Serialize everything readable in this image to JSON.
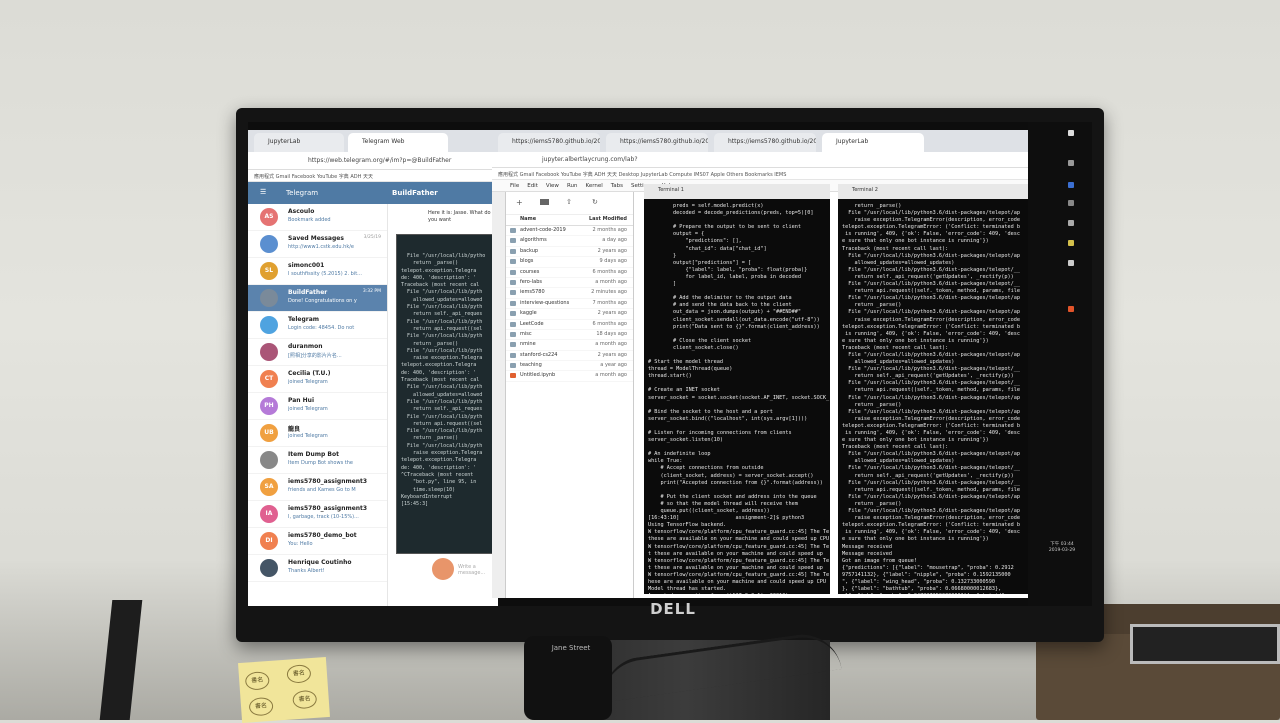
{
  "monitor": {
    "brand": "DELL"
  },
  "power_brick": {
    "label": "Jane Street"
  },
  "sticky_note": {
    "marks": [
      "書名",
      "書名",
      "書名",
      "書名"
    ]
  },
  "telegram": {
    "tab_title_1": "JupyterLab",
    "tab_title_2": "Telegram Web",
    "url": "https://web.telegram.org/#/im?p=@BuildFather",
    "bookmarks": "應用程式  Gmail  Facebook  YouTube  字典  ADH  天天",
    "header_app": "Telegram",
    "header_chat": "BuildFather",
    "bot_message": "Here it is: Jasse. What do you want",
    "input_placeholder": "Write a message...",
    "chats": [
      {
        "initials": "AS",
        "name": "Ascoulo",
        "preview": "Bookmark added",
        "time": "",
        "color": "#e57373"
      },
      {
        "initials": "",
        "name": "Saved Messages",
        "preview": "http://www1.cstk.edu.hk/e",
        "time": "3/25/19",
        "color": "#5b8fd0"
      },
      {
        "initials": "SL",
        "name": "simonc001",
        "preview": "I southfissity (5.2015) 2. bit...",
        "time": "",
        "color": "#e0a030"
      },
      {
        "initials": "",
        "name": "BuildFather",
        "preview": "Done! Congratulations on y",
        "time": "3:32 PM",
        "color": "#7a8a9a"
      },
      {
        "initials": "",
        "name": "Telegram",
        "preview": "Login code: 48454. Do not",
        "time": "",
        "color": "#4fa3e0"
      },
      {
        "initials": "",
        "name": "duranmon",
        "preview": "[照相]分享的影片片名...",
        "time": "",
        "color": "#aa5577"
      },
      {
        "initials": "CT",
        "name": "Cecilia (T.U.)",
        "preview": "joined Telegram",
        "time": "",
        "color": "#f08050"
      },
      {
        "initials": "PH",
        "name": "Pan Hui",
        "preview": "joined Telegram",
        "time": "",
        "color": "#b57ad8"
      },
      {
        "initials": "UB",
        "name": "龍良",
        "preview": "joined Telegram",
        "time": "",
        "color": "#f0a040"
      },
      {
        "initials": "",
        "name": "Item Dump Bot",
        "preview": "Item Dump Bot shows the",
        "time": "",
        "color": "#888888"
      },
      {
        "initials": "SA",
        "name": "iems5780_assignment3",
        "preview": "friends and Kames Go to M",
        "time": "",
        "color": "#f0a040"
      },
      {
        "initials": "IA",
        "name": "iems5780_assignment3",
        "preview": "I, garbage, track (10-15%)...",
        "time": "",
        "color": "#e06090"
      },
      {
        "initials": "DI",
        "name": "iems5780_demo_bot",
        "preview": "You: Hello",
        "time": "",
        "color": "#f08050"
      },
      {
        "initials": "",
        "name": "Henrique Coutinho",
        "preview": "Thanks Albert!",
        "time": "",
        "color": "#445566"
      }
    ]
  },
  "terminal_small": {
    "lines": [
      "  File \"/usr/local/lib/pytho",
      "    return _parse()",
      "telepot.exception.Telegra",
      "de: 400, 'description': '",
      "Traceback (most recent cal",
      "  File \"/usr/local/lib/pyth",
      "    allowed_updates=allowed",
      "  File \"/usr/local/lib/pyth",
      "    return self._api_reques",
      "  File \"/usr/local/lib/pyth",
      "    return api.request((sel",
      "  File \"/usr/local/lib/pyth",
      "    return _parse()",
      "  File \"/usr/local/lib/pyth",
      "    raise exception.Telegra",
      "telepot.exception.Telegra",
      "de: 400, 'description': '",
      "Traceback (most recent cal",
      "  File \"/usr/local/lib/pyth",
      "    allowed_updates=allowed",
      "  File \"/usr/local/lib/pyth",
      "    return self._api_reques",
      "  File \"/usr/local/lib/pyth",
      "    return api.request((sel",
      "  File \"/usr/local/lib/pyth",
      "    return _parse()",
      "  File \"/usr/local/lib/pyth",
      "    raise exception.Telegra",
      "telepot.exception.Telegra",
      "de: 400, 'description': '",
      "^CTraceback (most recent",
      "    \"bot.py\", line 95, in",
      "    time.sleep(10)",
      "KeyboardInterrupt",
      "[15:45:3]"
    ]
  },
  "jupyterlab": {
    "tabs": [
      "https://iems5780.github.io/20",
      "https://iems5780.github.io/20",
      "https://iems5780.github.io/20",
      "JupyterLab"
    ],
    "url": "jupyter.albertlaycrung.com/lab?",
    "bookmarks": "應用程式  Gmail  Facebook  YouTube  字典  ADH  天天  Desktop  JupyterLab  Compute  IMS07  Apple  Others  Bookmarks  IEMS",
    "menu": [
      "File",
      "Edit",
      "View",
      "Run",
      "Kernel",
      "Tabs",
      "Settings",
      "Help"
    ],
    "filebrowser": {
      "col_name": "Name",
      "col_modified": "Last Modified",
      "files": [
        {
          "name": "advent-code-2019",
          "modified": "2 months ago",
          "notebook": false
        },
        {
          "name": "algorithms",
          "modified": "a day ago",
          "notebook": false
        },
        {
          "name": "backup",
          "modified": "2 years ago",
          "notebook": false
        },
        {
          "name": "blogs",
          "modified": "9 days ago",
          "notebook": false
        },
        {
          "name": "courses",
          "modified": "6 months ago",
          "notebook": false
        },
        {
          "name": "fero-labs",
          "modified": "a month ago",
          "notebook": false
        },
        {
          "name": "iems5780",
          "modified": "2 minutes ago",
          "notebook": false
        },
        {
          "name": "interview-questions",
          "modified": "7 months ago",
          "notebook": false
        },
        {
          "name": "kaggle",
          "modified": "2 years ago",
          "notebook": false
        },
        {
          "name": "LeetCode",
          "modified": "6 months ago",
          "notebook": false
        },
        {
          "name": "misc",
          "modified": "18 days ago",
          "notebook": false
        },
        {
          "name": "nmine",
          "modified": "a month ago",
          "notebook": false
        },
        {
          "name": "stanford-cs224",
          "modified": "2 years ago",
          "notebook": false
        },
        {
          "name": "teaching",
          "modified": "a year ago",
          "notebook": false
        },
        {
          "name": "Untitled.ipynb",
          "modified": "a month ago",
          "notebook": true
        }
      ]
    },
    "terminal_1": {
      "title": "Terminal 1",
      "lines": [
        "        preds = self.model.predict(x)",
        "        decoded = decode_predictions(preds, top=5)[0]",
        "",
        "        # Prepare the output to be sent to client",
        "        output = {",
        "            \"predictions\": [],",
        "            \"chat_id\": data[\"chat_id\"]",
        "        }",
        "        output[\"predictions\"] = [",
        "            {\"label\": label, \"proba\": float(proba)}",
        "            for label_id, label, proba in decoded",
        "        ]",
        "",
        "        # Add the delimiter to the output data",
        "        # and send the data back to the client",
        "        out_data = json.dumps(output) + \"##END##\"",
        "        client_socket.sendall(out_data.encode(\"utf-8\"))",
        "        print(\"Data sent to {}\".format(client_address))",
        "",
        "        # Close the client socket",
        "        client_socket.close()",
        "",
        "# Start the model thread",
        "thread = ModelThread(queue)",
        "thread.start()",
        "",
        "# Create an INET socket",
        "server_socket = socket.socket(socket.AF_INET, socket.SOCK_",
        "",
        "# Bind the socket to the host and a port",
        "server_socket.bind((\"localhost\", int(sys.argv[1])))",
        "",
        "# Listen for incoming connections from clients",
        "server_socket.listen(10)",
        "",
        "# An indefinite loop",
        "while True:",
        "    # Accept connections from outside",
        "    (client_socket, address) = server_socket.accept()",
        "    print(\"Accepted connection from {}\".format(address))",
        "",
        "    # Put the client socket and address into the queue",
        "    # so that the model thread will receive them",
        "    queue.put((client_socket, address))",
        "[16:43:10]                  assignment-2]$ python3",
        "Using TensorFlow backend.",
        "W tensorflow/core/platform/cpu_feature_guard.cc:45] The Te",
        "these are available on your machine and could speed up CPU",
        "W tensorflow/core/platform/cpu_feature_guard.cc:45] The Te",
        "t these are available on your machine and could speed up",
        "W tensorflow/core/platform/cpu_feature_guard.cc:45] The Te",
        "t these are available on your machine and could speed up",
        "W tensorflow/core/platform/cpu_feature_guard.cc:45] The Te",
        "hese are available on your machine and could speed up CPU",
        "Model thread has started.",
        "Accepted connection from ('127.0.0.1', 33010)",
        "Got ('127.0.0.1', 33010) from queue.",
        "Data sent to ('127.0.0.1', 33010)"
      ]
    },
    "terminal_2": {
      "title": "Terminal 2",
      "lines": [
        "    return _parse()",
        "  File \"/usr/local/lib/python3.6/dist-packages/telepot/ap",
        "    raise exception.TelegramError(description, error_code",
        "telepot.exception.TelegramError: ('Conflict: terminated b",
        " is running', 409, {'ok': False, 'error_code': 409, 'desc",
        "e sure that only one bot instance is running'})",
        "Traceback (most recent call last):",
        "  File \"/usr/local/lib/python3.6/dist-packages/telepot/ap",
        "    allowed_updates=allowed_updates)",
        "  File \"/usr/local/lib/python3.6/dist-packages/telepot/__",
        "    return self._api_request('getUpdates', _rectify(p))",
        "  File \"/usr/local/lib/python3.6/dist-packages/telepot/__",
        "    return api.request((self._token, method, params, file",
        "  File \"/usr/local/lib/python3.6/dist-packages/telepot/ap",
        "    return _parse()",
        "  File \"/usr/local/lib/python3.6/dist-packages/telepot/ap",
        "    raise exception.TelegramError(description, error_code",
        "telepot.exception.TelegramError: ('Conflict: terminated b",
        " is running', 409, {'ok': False, 'error_code': 409, 'desc",
        "e sure that only one bot instance is running'})",
        "Traceback (most recent call last):",
        "  File \"/usr/local/lib/python3.6/dist-packages/telepot/ap",
        "    allowed_updates=allowed_updates)",
        "  File \"/usr/local/lib/python3.6/dist-packages/telepot/__",
        "    return self._api_request('getUpdates', _rectify(p))",
        "  File \"/usr/local/lib/python3.6/dist-packages/telepot/__",
        "    return api.request((self._token, method, params, file",
        "  File \"/usr/local/lib/python3.6/dist-packages/telepot/ap",
        "    return _parse()",
        "  File \"/usr/local/lib/python3.6/dist-packages/telepot/ap",
        "    raise exception.TelegramError(description, error_code",
        "telepot.exception.TelegramError: ('Conflict: terminated b",
        " is running', 409, {'ok': False, 'error_code': 409, 'desc",
        "e sure that only one bot instance is running'})",
        "Traceback (most recent call last):",
        "  File \"/usr/local/lib/python3.6/dist-packages/telepot/ap",
        "    allowed_updates=allowed_updates)",
        "  File \"/usr/local/lib/python3.6/dist-packages/telepot/__",
        "    return self._api_request('getUpdates', _rectify(p))",
        "  File \"/usr/local/lib/python3.6/dist-packages/telepot/__",
        "    return api.request((self._token, method, params, file",
        "  File \"/usr/local/lib/python3.6/dist-packages/telepot/ap",
        "    return _parse()",
        "  File \"/usr/local/lib/python3.6/dist-packages/telepot/ap",
        "    raise exception.TelegramError(description, error_code",
        "telepot.exception.TelegramError: ('Conflict: terminated b",
        " is running', 409, {'ok': False, 'error_code': 409, 'desc",
        "e sure that only one bot instance is running'})",
        "Message received",
        "Message received",
        "Got an image from queue!",
        "{\"predictions\": [{\"label\": \"mousetrap\", \"proba\": 0.2912",
        "9757141132}, {\"label\": \"nipple\", \"proba\": 0.1592135000",
        "\", {\"label\": \"wing_head\", \"proba\": 0.132733000590",
        "}, {\"label\": \"bathtub\", \"proba\": 0.06680000012683},",
        "al\": \"tub\", \"proba\": 0.0478272502000001}], \"chat_id\"",
        "1972064}",
        "Message sent to user"
      ]
    }
  },
  "clock": {
    "time": "下午 03:44",
    "date": "2019-03-29"
  }
}
